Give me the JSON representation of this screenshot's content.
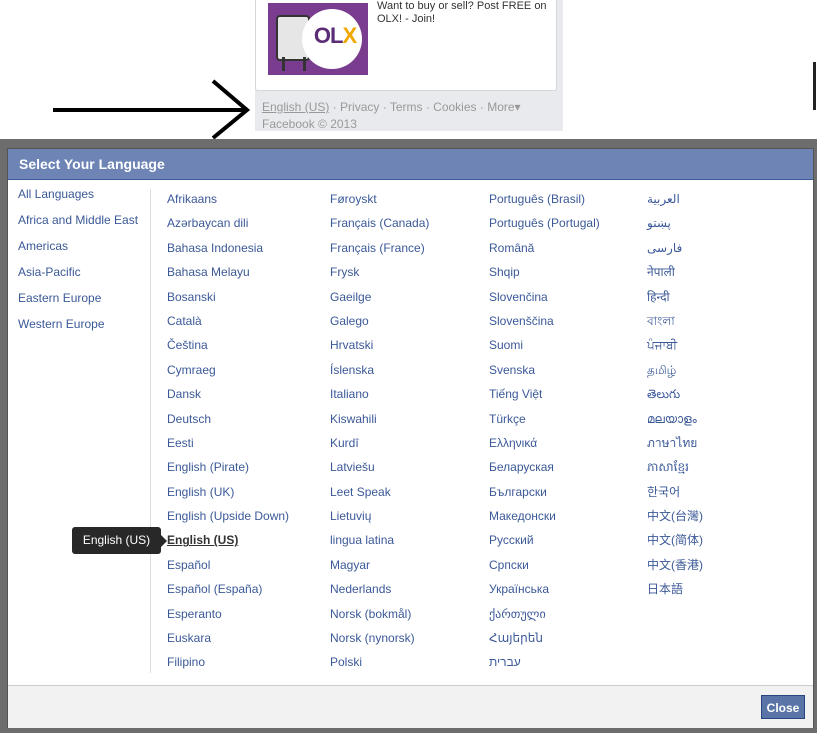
{
  "background": {
    "ad": {
      "text": "Want to buy or sell? Post FREE on OLX! - Join!",
      "logo_text_ol": "OL",
      "logo_text_x": "X"
    },
    "footer": {
      "links": [
        "English (US)",
        "Privacy",
        "Terms",
        "Cookies",
        "More"
      ],
      "separator": " · ",
      "more_arrow": "▾",
      "copyright": "Facebook © 2013"
    }
  },
  "dialog": {
    "title": "Select Your Language",
    "categories": [
      "All Languages",
      "Africa and Middle East",
      "Americas",
      "Asia-Pacific",
      "Eastern Europe",
      "Western Europe"
    ],
    "columns": [
      [
        "Afrikaans",
        "Azərbaycan dili",
        "Bahasa Indonesia",
        "Bahasa Melayu",
        "Bosanski",
        "Català",
        "Čeština",
        "Cymraeg",
        "Dansk",
        "Deutsch",
        "Eesti",
        "English (Pirate)",
        "English (UK)",
        "English (Upside Down)",
        "English (US)",
        "Español",
        "Español (España)",
        "Esperanto",
        "Euskara",
        "Filipino"
      ],
      [
        "Føroyskt",
        "Français (Canada)",
        "Français (France)",
        "Frysk",
        "Gaeilge",
        "Galego",
        "Hrvatski",
        "Íslenska",
        "Italiano",
        "Kiswahili",
        "Kurdî",
        "Latviešu",
        "Leet Speak",
        "Lietuvių",
        "lingua latina",
        "Magyar",
        "Nederlands",
        "Norsk (bokmål)",
        "Norsk (nynorsk)",
        "Polski"
      ],
      [
        "Português (Brasil)",
        "Português (Portugal)",
        "Română",
        "Shqip",
        "Slovenčina",
        "Slovenščina",
        "Suomi",
        "Svenska",
        "Tiếng Việt",
        "Türkçe",
        "Ελληνικά",
        "Беларуская",
        "Български",
        "Македонски",
        "Русский",
        "Српски",
        "Українська",
        "ქართული",
        "Հայերեն",
        "עברית"
      ],
      [
        "العربية",
        "پښتو",
        "فارسی",
        "नेपाली",
        "हिन्दी",
        "বাংলা",
        "ਪੰਜਾਬੀ",
        "தமிழ்",
        "తెలుగు",
        "മലയാളം",
        "ภาษาไทย",
        "ភាសាខ្មែរ",
        "한국어",
        "中文(台灣)",
        "中文(简体)",
        "中文(香港)",
        "日本語"
      ]
    ],
    "selected_language": "English (US)",
    "close_label": "Close"
  },
  "tooltip": {
    "text": "English (US)"
  },
  "icons": {
    "arrow": "arrow-right-icon"
  }
}
